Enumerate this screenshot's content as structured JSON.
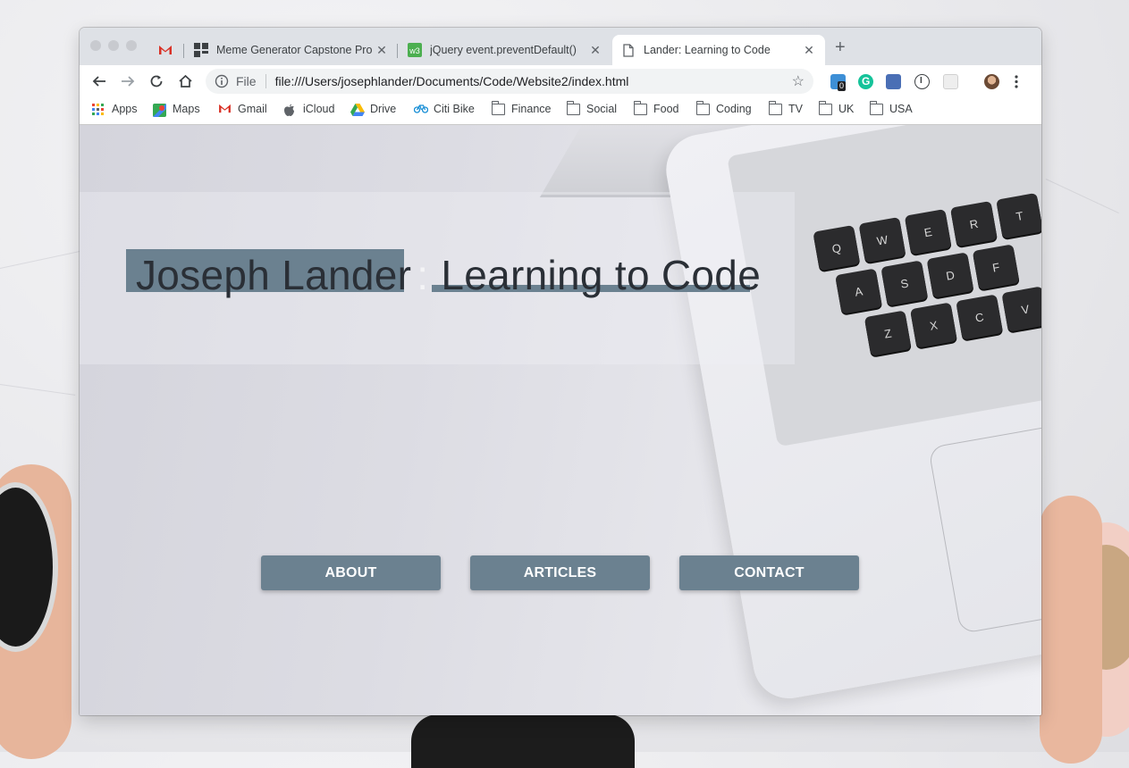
{
  "browser": {
    "tabs": [
      {
        "title": "",
        "icon": "gmail-icon"
      },
      {
        "title": "Meme Generator Capstone Pro",
        "icon": "grid-app-icon"
      },
      {
        "title": "jQuery event.preventDefault()",
        "icon": "w3schools-icon"
      },
      {
        "title": "Lander: Learning to Code",
        "icon": "page-icon",
        "active": true
      }
    ],
    "omnibox": {
      "scheme": "File",
      "url": "file:///Users/josephlander/Documents/Code/Website2/index.html"
    },
    "extensions": {
      "badge_count": "0"
    },
    "bookmarks": [
      {
        "label": "Apps",
        "icon": "apps-grid-icon"
      },
      {
        "label": "Maps",
        "icon": "maps-icon"
      },
      {
        "label": "Gmail",
        "icon": "gmail-icon"
      },
      {
        "label": "iCloud",
        "icon": "apple-icon"
      },
      {
        "label": "Drive",
        "icon": "drive-icon"
      },
      {
        "label": "Citi Bike",
        "icon": "bike-icon"
      },
      {
        "label": "Finance",
        "icon": "folder-icon"
      },
      {
        "label": "Social",
        "icon": "folder-icon"
      },
      {
        "label": "Food",
        "icon": "folder-icon"
      },
      {
        "label": "Coding",
        "icon": "folder-icon"
      },
      {
        "label": "TV",
        "icon": "folder-icon"
      },
      {
        "label": "UK",
        "icon": "folder-icon"
      },
      {
        "label": "USA",
        "icon": "folder-icon"
      }
    ]
  },
  "page": {
    "name": "Joseph Lander",
    "separator": ":",
    "tagline": "Learning to Code",
    "nav": [
      {
        "label": "ABOUT"
      },
      {
        "label": "ARTICLES"
      },
      {
        "label": "CONTACT"
      }
    ],
    "keyboard_keys": [
      "Q",
      "W",
      "E",
      "R",
      "T",
      "A",
      "S",
      "D",
      "F",
      "Z",
      "X",
      "C",
      "V"
    ]
  },
  "colors": {
    "accent": "#6b8190",
    "headline_text": "#2a2f36",
    "tabbar": "#dee1e6"
  }
}
